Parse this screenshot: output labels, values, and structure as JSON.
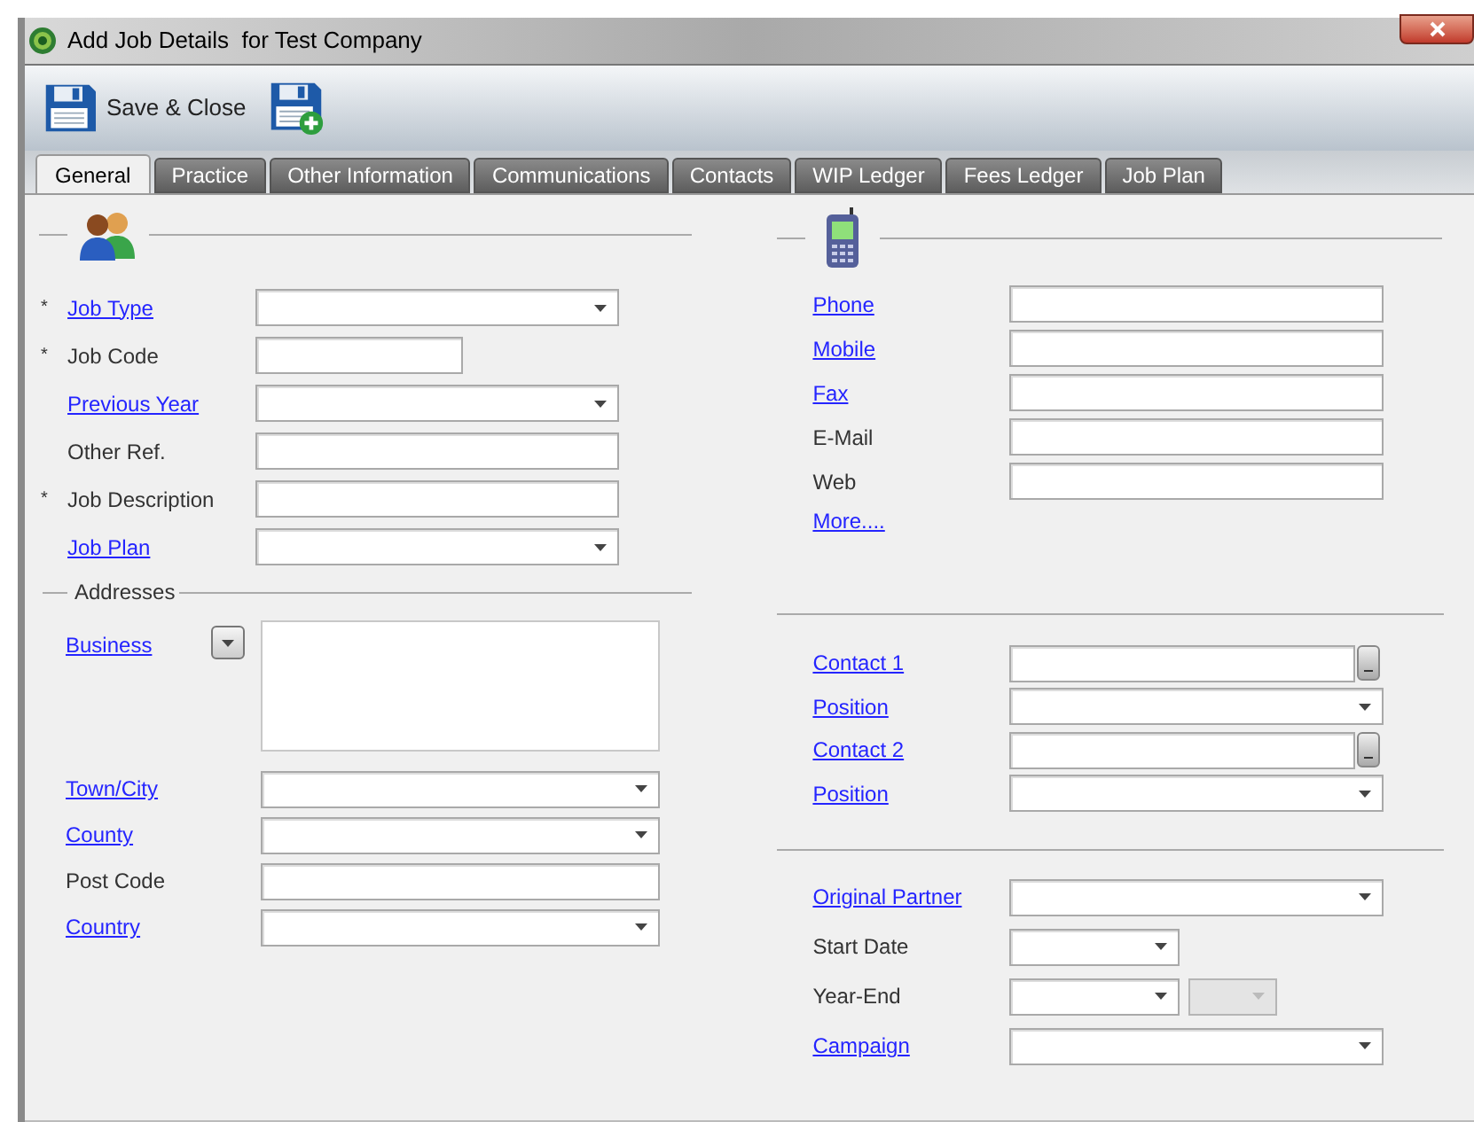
{
  "window": {
    "title": "Add Job Details  for Test Company"
  },
  "toolbar": [
    {
      "kind": "save-close",
      "label": "Save & Close"
    },
    {
      "kind": "save-new"
    }
  ],
  "tabs": [
    {
      "label": "General",
      "selected": true
    },
    {
      "label": "Practice",
      "selected": false
    },
    {
      "label": "Other Information",
      "selected": false
    },
    {
      "label": "Communications",
      "selected": false
    },
    {
      "label": "Contacts",
      "selected": false
    },
    {
      "label": "WIP Ledger",
      "selected": false
    },
    {
      "label": "Fees Ledger",
      "selected": false
    },
    {
      "label": "Job Plan",
      "selected": false
    }
  ],
  "job_fields": [
    {
      "marker": "*",
      "label": "Job Type",
      "link": true,
      "kind": "combo"
    },
    {
      "marker": "*",
      "label": "Job Code",
      "link": false,
      "kind": "short_text"
    },
    {
      "label": "Previous Year",
      "link": true,
      "kind": "combo"
    },
    {
      "label": "Other Ref.",
      "link": false,
      "kind": "text"
    },
    {
      "marker": "*",
      "label": "Job Description",
      "link": false,
      "kind": "text"
    },
    {
      "label": "Job Plan",
      "link": true,
      "kind": "combo"
    }
  ],
  "addresses": {
    "title": "Addresses",
    "fields": [
      {
        "label": "Business",
        "link": true,
        "kind": "memo"
      },
      {
        "label": "Town/City",
        "link": true,
        "kind": "combo"
      },
      {
        "label": "County",
        "link": true,
        "kind": "combo"
      },
      {
        "label": "Post Code",
        "link": false,
        "kind": "text"
      },
      {
        "label": "Country",
        "link": true,
        "kind": "combo"
      }
    ]
  },
  "communication_fields": [
    {
      "label": "Phone",
      "link": true,
      "kind": "text"
    },
    {
      "label": "Mobile",
      "link": true,
      "kind": "text"
    },
    {
      "label": "Fax",
      "link": true,
      "kind": "text"
    },
    {
      "label": "E-Mail",
      "link": false,
      "kind": "text"
    },
    {
      "label": "Web",
      "link": false,
      "kind": "text"
    },
    {
      "label": "More....",
      "link": true,
      "kind": "none"
    }
  ],
  "contact_fields": [
    {
      "label": "Contact 1",
      "link": true,
      "kind": "lookup"
    },
    {
      "label": "Position",
      "link": true,
      "kind": "combo"
    },
    {
      "label": "Contact 2",
      "link": true,
      "kind": "lookup"
    },
    {
      "label": "Position",
      "link": true,
      "kind": "combo"
    }
  ],
  "other_fields": [
    {
      "label": "Original Partner",
      "link": true,
      "kind": "combo"
    },
    {
      "label": "Start Date",
      "link": false,
      "kind": "short_combo"
    },
    {
      "label": "Year-End",
      "link": false,
      "kind": "short_combo_pair"
    },
    {
      "label": "Campaign",
      "link": true,
      "kind": "combo"
    }
  ]
}
